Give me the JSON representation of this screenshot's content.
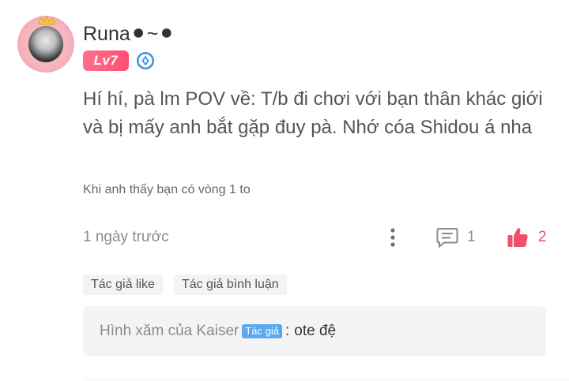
{
  "comment": {
    "username": "Runa⚫~⚫",
    "level": "Lv7",
    "content": "Hí hí, pà lm POV về: T/b đi chơi với bạn thân khác giới và bị mấy anh bắt gặp đuy pà. Nhớ cóa Shidou á nha",
    "chapter_ref": "Khi anh thấy bạn có vòng 1 to",
    "timestamp": "1 ngày trước",
    "reply_count": "1",
    "like_count": "2",
    "tags": [
      "Tác giả like",
      "Tác giả bình luận"
    ],
    "reply_preview": {
      "author": "Hình xăm của Kaiser",
      "author_badge": "Tác giả",
      "separator": ":",
      "text": "ote đệ"
    }
  },
  "colors": {
    "like_accent": "#f0506e",
    "level_badge": "#ff5a7a",
    "author_badge": "#5aa9f0",
    "verified_badge": "#3d8fe6"
  },
  "icons": {
    "verified": "verified-diamond-icon",
    "more": "more-vertical-icon",
    "reply": "comment-icon",
    "like": "thumbs-up-icon"
  }
}
